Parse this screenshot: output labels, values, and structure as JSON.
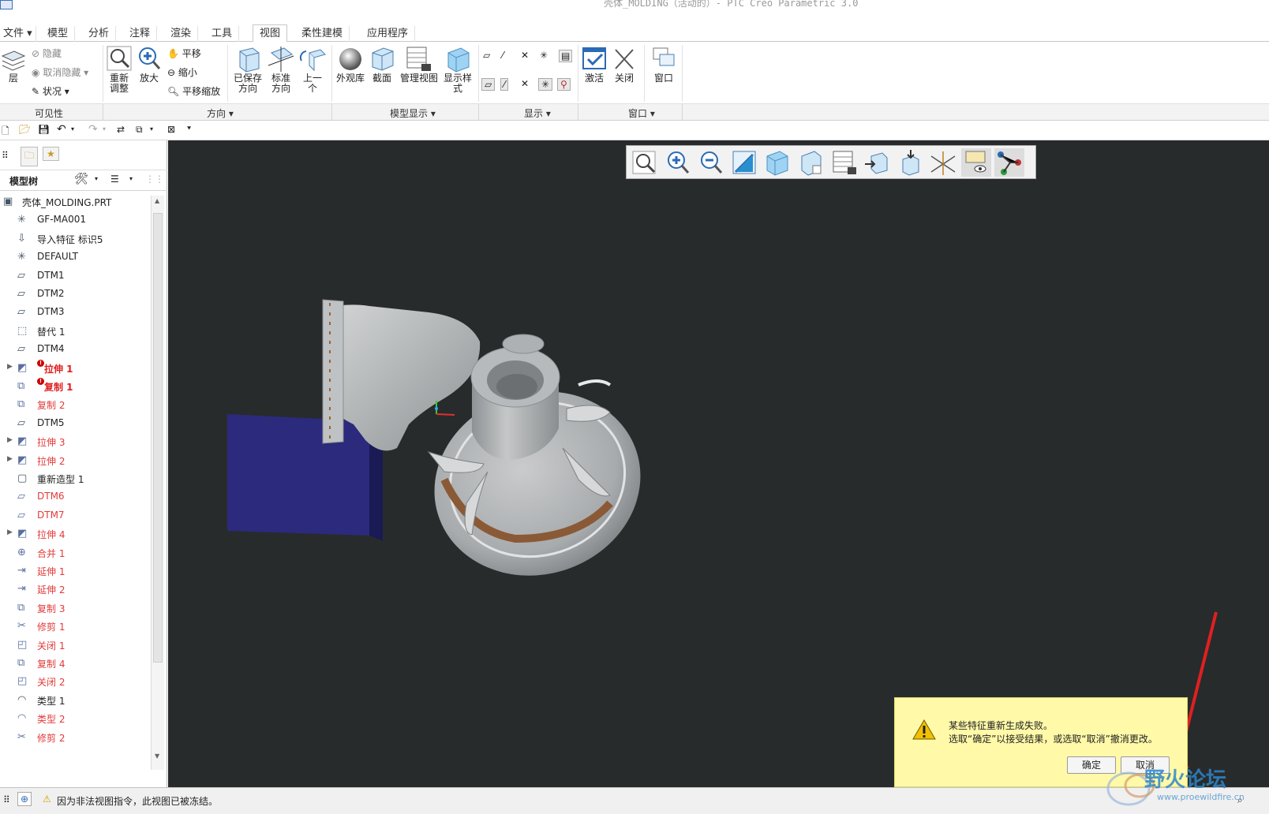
{
  "window": {
    "title": "壳体_MOLDING（活动的）- PTC Creo Parametric 3.0"
  },
  "tabs": [
    {
      "label": "文件",
      "has_arrow": true
    },
    {
      "label": "模型"
    },
    {
      "label": "分析"
    },
    {
      "label": "注释"
    },
    {
      "label": "渲染"
    },
    {
      "label": "工具"
    },
    {
      "label": "视图",
      "active": true
    },
    {
      "label": "柔性建模"
    },
    {
      "label": "应用程序"
    }
  ],
  "ribbon": {
    "visibility": {
      "layers": "层",
      "hide": "隐藏",
      "unhide": "取消隐藏",
      "status": "状况",
      "label": "可见性"
    },
    "orientation": {
      "refit": "重新\n调整",
      "zoom_in": "放大",
      "pan": "平移",
      "zoom_out": "缩小",
      "pan_zoom": "平移缩放",
      "saved_orient": "已保存\n方向",
      "std_orient": "标准\n方向",
      "previous": "上一\n个",
      "label": "方向"
    },
    "model_display": {
      "appearance": "外观库",
      "section": "截面",
      "manage_views": "管理视图",
      "display_style": "显示样\n式",
      "label": "模型显示"
    },
    "show": {
      "label": "显示"
    },
    "window": {
      "activate": "激活",
      "close": "关闭",
      "window": "窗口",
      "label": "窗口"
    }
  },
  "sidebar": {
    "header": "模型树",
    "tree": [
      {
        "label": "壳体_MOLDING.PRT",
        "icon": "part-icon",
        "color": "black",
        "top": true
      },
      {
        "label": "GF-MA001",
        "icon": "csys-icon",
        "color": "black"
      },
      {
        "label": "导入特征 标识5",
        "icon": "import-icon",
        "color": "black"
      },
      {
        "label": "DEFAULT",
        "icon": "csys-icon",
        "color": "black"
      },
      {
        "label": "DTM1",
        "icon": "datum-plane-icon",
        "color": "black"
      },
      {
        "label": "DTM2",
        "icon": "datum-plane-icon",
        "color": "black"
      },
      {
        "label": "DTM3",
        "icon": "datum-plane-icon",
        "color": "black"
      },
      {
        "label": "替代 1",
        "icon": "substitute-icon",
        "color": "black"
      },
      {
        "label": "DTM4",
        "icon": "datum-plane-icon",
        "color": "black"
      },
      {
        "label": "拉伸 1",
        "icon": "extrude-icon",
        "color": "redb",
        "expand": true,
        "error": true
      },
      {
        "label": "复制 1",
        "icon": "copy-icon",
        "color": "redb",
        "error": true
      },
      {
        "label": "复制 2",
        "icon": "copy-icon",
        "color": "red"
      },
      {
        "label": "DTM5",
        "icon": "datum-plane-icon",
        "color": "black"
      },
      {
        "label": "拉伸 3",
        "icon": "extrude-icon",
        "color": "red",
        "expand": true
      },
      {
        "label": "拉伸 2",
        "icon": "extrude-icon",
        "color": "red",
        "expand": true
      },
      {
        "label": "重新造型 1",
        "icon": "restyle-icon",
        "color": "black"
      },
      {
        "label": "DTM6",
        "icon": "datum-plane-icon",
        "color": "red"
      },
      {
        "label": "DTM7",
        "icon": "datum-plane-icon",
        "color": "red"
      },
      {
        "label": "拉伸 4",
        "icon": "extrude-icon",
        "color": "red",
        "expand": true
      },
      {
        "label": "合并 1",
        "icon": "merge-icon",
        "color": "red"
      },
      {
        "label": "延伸 1",
        "icon": "extend-icon",
        "color": "red"
      },
      {
        "label": "延伸 2",
        "icon": "extend-icon",
        "color": "red"
      },
      {
        "label": "复制 3",
        "icon": "copy-icon",
        "color": "red"
      },
      {
        "label": "修剪 1",
        "icon": "trim-icon",
        "color": "red"
      },
      {
        "label": "关闭 1",
        "icon": "close-surface-icon",
        "color": "red"
      },
      {
        "label": "复制 4",
        "icon": "copy-icon",
        "color": "red"
      },
      {
        "label": "关闭 2",
        "icon": "close-surface-icon",
        "color": "red"
      },
      {
        "label": "类型 1",
        "icon": "style-icon",
        "color": "black"
      },
      {
        "label": "类型 2",
        "icon": "style-icon",
        "color": "red"
      },
      {
        "label": "修剪 2",
        "icon": "trim-icon",
        "color": "red"
      }
    ]
  },
  "dialog": {
    "line1": "某些特征重新生成失败。",
    "line2": "选取“确定”以接受结果，或选取“取消”撤消更改。",
    "ok": "确定",
    "cancel": "取消"
  },
  "status": {
    "message": "因为非法视图指令，此视图已被冻结。"
  },
  "watermark": {
    "text": "野火论坛",
    "url": "www.proewildfire.cn"
  },
  "colors": {
    "viewport_bg": "#282b2c",
    "model_gray": "#a9acae",
    "model_blue": "#2a2a7a",
    "error_red": "#e23a3a",
    "dialog_bg": "#fff9a8"
  }
}
